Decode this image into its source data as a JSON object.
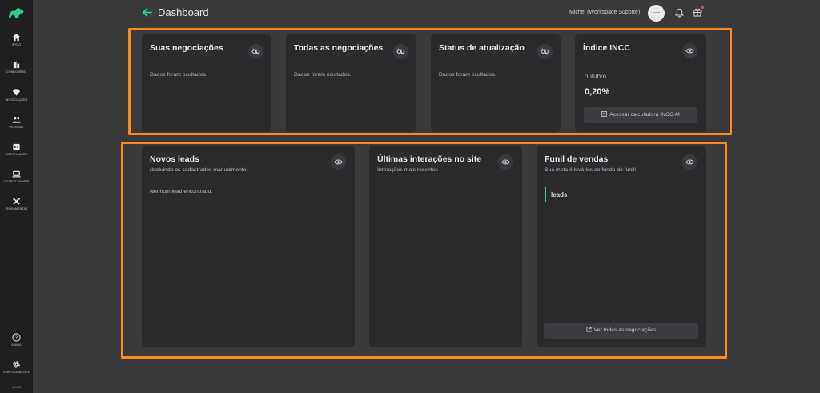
{
  "header": {
    "title": "Dashboard",
    "user_name": "Michel (Workspace Suporte)"
  },
  "sidebar": {
    "items": [
      {
        "label": "Início",
        "icon": "home-icon"
      },
      {
        "label": "Condomínio",
        "icon": "building-icon"
      },
      {
        "label": "Negociações",
        "icon": "diamond-icon"
      },
      {
        "label": "Pessoas",
        "icon": "people-icon"
      },
      {
        "label": "Integrações",
        "icon": "integrations-icon"
      },
      {
        "label": "Outros painéis",
        "icon": "laptop-icon"
      },
      {
        "label": "Ferramentas",
        "icon": "tools-icon"
      }
    ],
    "help_label": "Ajuda",
    "settings_label": "Configurações",
    "version": "v2.1.0"
  },
  "cards_top": [
    {
      "title": "Suas negociações",
      "body": "Dados foram ocultados.",
      "eye_state": "hidden"
    },
    {
      "title": "Todas as negociações",
      "body": "Dados foram ocultados.",
      "eye_state": "hidden"
    },
    {
      "title": "Status de atualização",
      "body": "Dados foram ocultados.",
      "eye_state": "hidden"
    },
    {
      "title": "Índice INCC",
      "month": "outubro",
      "value": "0,20%",
      "button": "Acessar calculadora INCC-M",
      "eye_state": "visible"
    }
  ],
  "cards_bottom": [
    {
      "title": "Novos leads",
      "subtitle": "(Incluindo os cadastrados manualmente)",
      "body": "Nenhum lead encontrado.",
      "eye_state": "visible"
    },
    {
      "title": "Últimas interações no site",
      "subtitle": "Interações mais recentes",
      "eye_state": "visible"
    },
    {
      "title": "Funil de vendas",
      "subtitle": "Sua meta é levá-los ao fundo do funil!",
      "funnel_item": "leads",
      "button": "Ver todas as negociações",
      "eye_state": "visible"
    }
  ],
  "colors": {
    "accent": "#2fcf8a",
    "highlight": "#ff8a1f",
    "sidebar_bg": "#1f1f21",
    "card_bg": "#2b2b2e",
    "page_bg": "#3a3a3d"
  }
}
